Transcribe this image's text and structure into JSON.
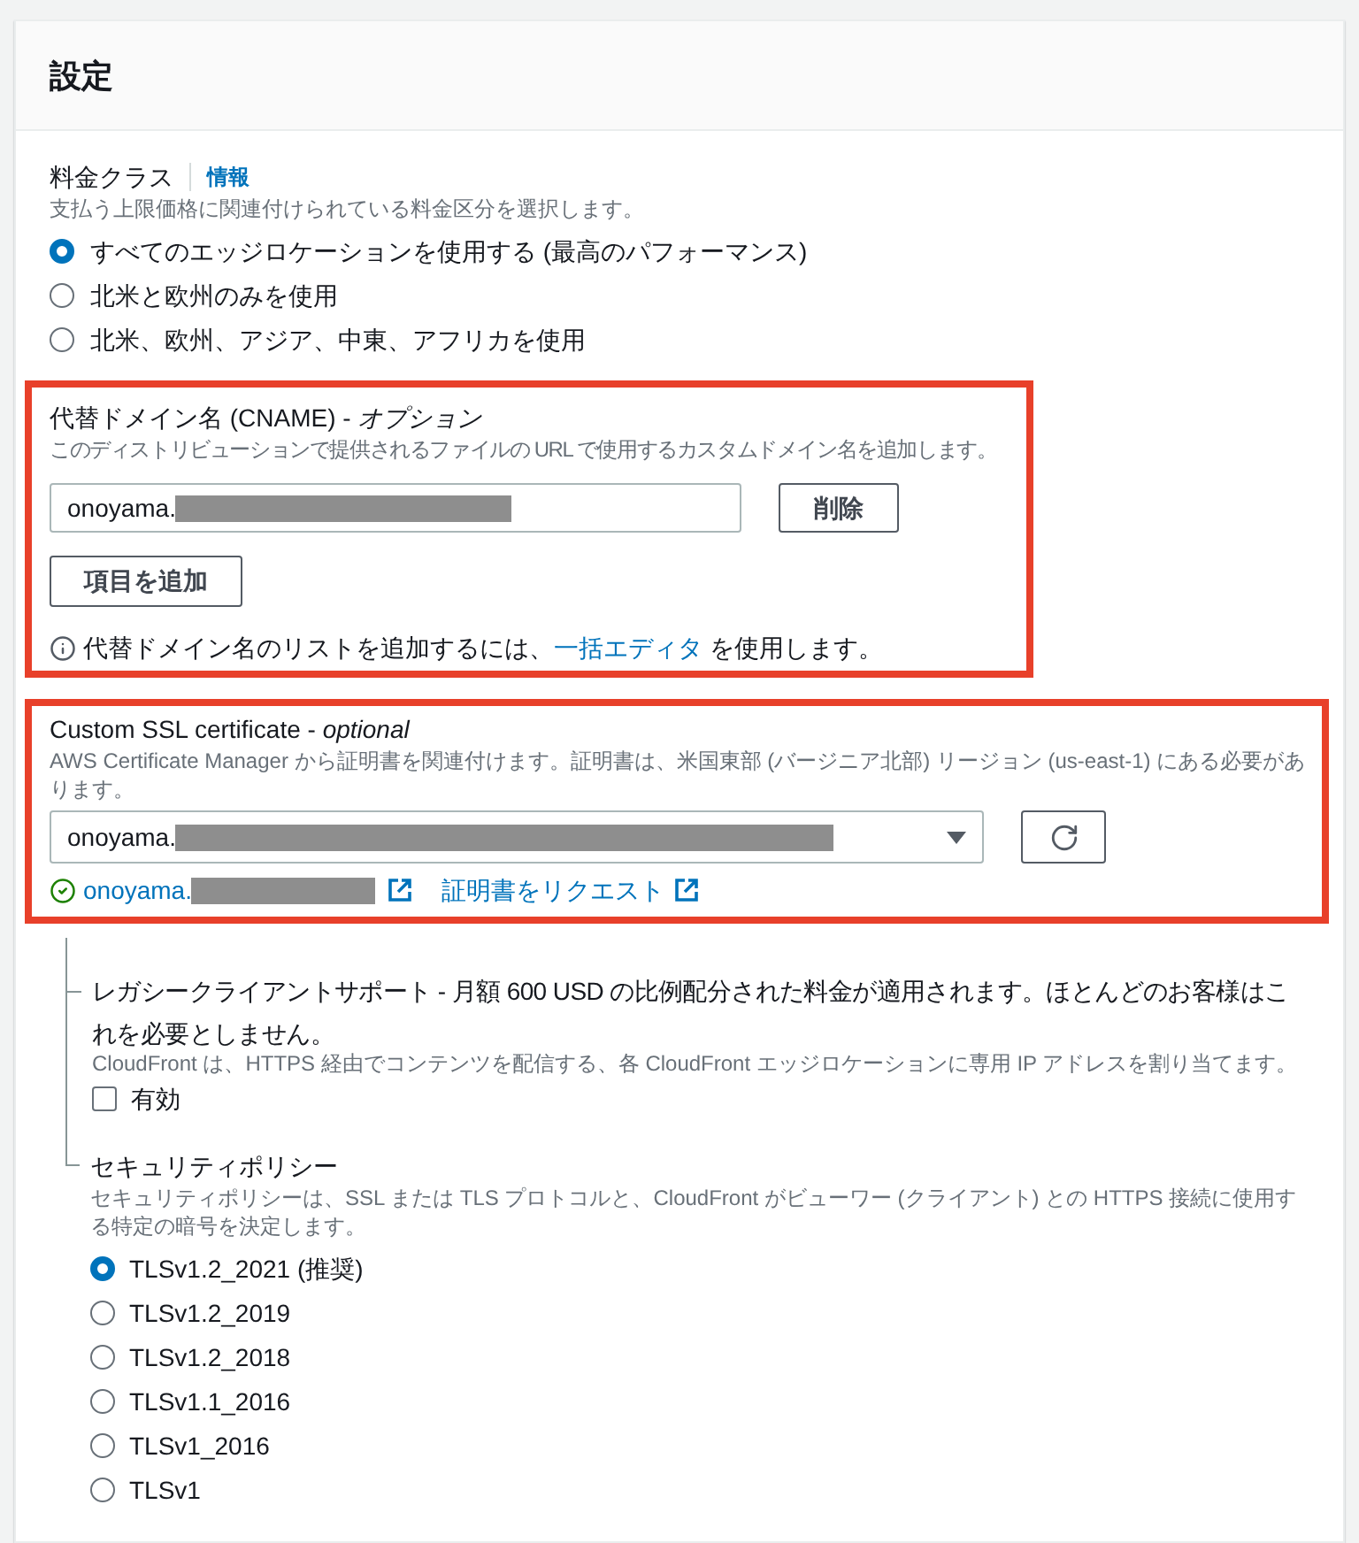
{
  "panel": {
    "title": "設定"
  },
  "price_class": {
    "label": "料金クラス",
    "info_link": "情報",
    "description": "支払う上限価格に関連付けられている料金区分を選択します。",
    "options": [
      {
        "label": "すべてのエッジロケーションを使用する (最高のパフォーマンス)",
        "selected": true
      },
      {
        "label": "北米と欧州のみを使用",
        "selected": false
      },
      {
        "label": "北米、欧州、アジア、中東、アフリカを使用",
        "selected": false
      }
    ]
  },
  "alternate_domains": {
    "highlighted": true,
    "label": "代替ドメイン名 (CNAME) - *オプション*",
    "description": "このディストリビューションで提供されるファイルの URL で使用するカスタムドメイン名を追加します。",
    "items": [
      {
        "value": "onoyama.",
        "redacted": true,
        "remove_button": "削除"
      }
    ],
    "add_button": "項目を追加",
    "hint": {
      "text_before": "代替ドメイン名のリストを追加するには、",
      "link": "一括エディタ",
      "text_after": " を使用します。"
    }
  },
  "ssl_certificate": {
    "highlighted": true,
    "label": "Custom SSL certificate - *optional*",
    "description": "AWS Certificate Manager から証明書を関連付けます。証明書は、米国東部 (バージニア北部) リージョン (us-east-1) にある必要があります。",
    "select": {
      "value": "onoyama.",
      "redacted": true
    },
    "certificate_link": {
      "text": "onoyama.",
      "redacted": true
    },
    "request_link": "証明書をリクエスト"
  },
  "legacy_client_support": {
    "label": "レガシークライアントサポート - 月額 600 USD の比例配分された料金が適用されます。ほとんどのお客様はこれを必要としません。",
    "description": "CloudFront は、HTTPS 経由でコンテンツを配信する、各 CloudFront エッジロケーションに専用 IP アドレスを割り当てます。",
    "checkbox": {
      "label": "有効",
      "checked": false
    }
  },
  "security_policy": {
    "label": "セキュリティポリシー",
    "description": "セキュリティポリシーは、SSL または TLS プロトコルと、CloudFront がビューワー (クライアント) との HTTPS 接続に使用する特定の暗号を決定します。",
    "options": [
      {
        "label": "TLSv1.2_2021 (推奨)",
        "selected": true
      },
      {
        "label": "TLSv1.2_2019",
        "selected": false
      },
      {
        "label": "TLSv1.2_2018",
        "selected": false
      },
      {
        "label": "TLSv1.1_2016",
        "selected": false
      },
      {
        "label": "TLSv1_2016",
        "selected": false
      },
      {
        "label": "TLSv1",
        "selected": false
      }
    ]
  }
}
